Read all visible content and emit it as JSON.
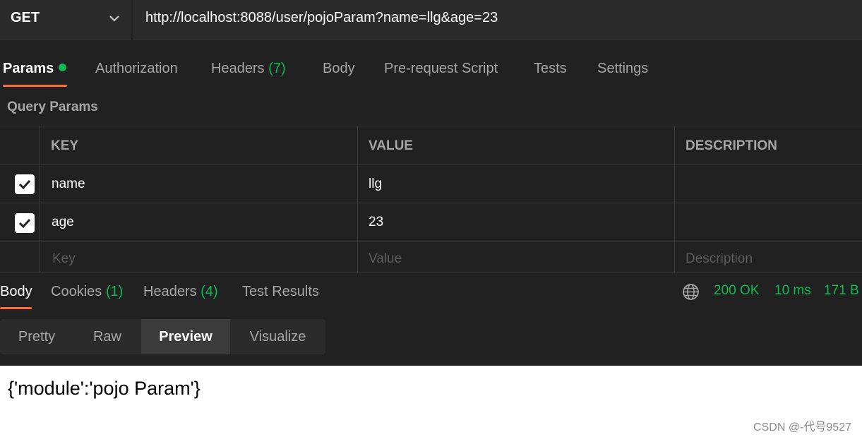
{
  "request": {
    "method": "GET",
    "url": "http://localhost:8088/user/pojoParam?name=llg&age=23"
  },
  "request_tabs": [
    {
      "label": "Params",
      "active": true,
      "has_dot": true
    },
    {
      "label": "Authorization"
    },
    {
      "label": "Headers",
      "count": "(7)"
    },
    {
      "label": "Body"
    },
    {
      "label": "Pre-request Script"
    },
    {
      "label": "Tests"
    },
    {
      "label": "Settings"
    }
  ],
  "query_params": {
    "title": "Query Params",
    "columns": [
      "KEY",
      "VALUE",
      "DESCRIPTION"
    ],
    "rows": [
      {
        "checked": true,
        "key": "name",
        "value": "llg",
        "description": ""
      },
      {
        "checked": true,
        "key": "age",
        "value": "23",
        "description": ""
      }
    ],
    "placeholders": {
      "key": "Key",
      "value": "Value",
      "description": "Description"
    }
  },
  "response_tabs": [
    {
      "label": "Body",
      "active": true
    },
    {
      "label": "Cookies",
      "count": "(1)"
    },
    {
      "label": "Headers",
      "count": "(4)"
    },
    {
      "label": "Test Results"
    }
  ],
  "response_status": {
    "status": "200 OK",
    "time": "10 ms",
    "size": "171 B"
  },
  "view_modes": [
    {
      "label": "Pretty"
    },
    {
      "label": "Raw"
    },
    {
      "label": "Preview",
      "active": true
    },
    {
      "label": "Visualize"
    }
  ],
  "preview_body": "{'module':'pojo Param'}",
  "watermark": "CSDN @-代号9527",
  "colors": {
    "background": "#212121",
    "accent": "#ff6c37",
    "success": "#0cbb52",
    "muted_text": "#a6a6a6"
  },
  "icons": [
    "chevron-down-icon",
    "check-icon",
    "globe-icon"
  ]
}
